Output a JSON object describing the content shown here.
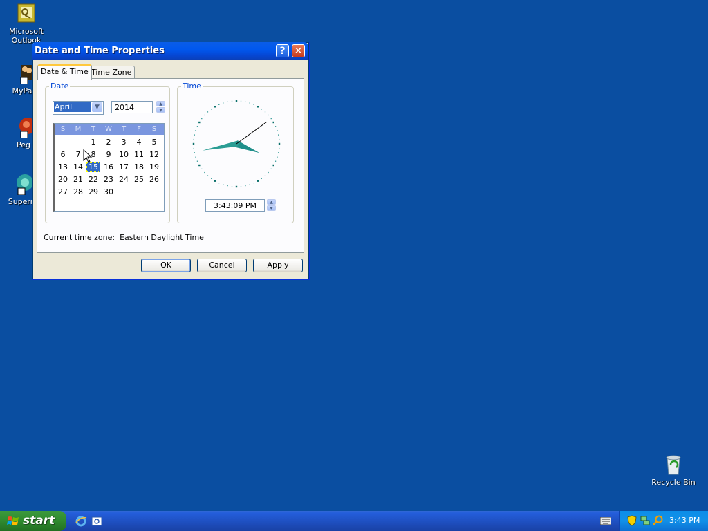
{
  "desktop": {
    "icons": [
      {
        "label": "Microsoft Outlook",
        "line1": "Microsoft",
        "line2": "Outlook"
      },
      {
        "label": "MyPa"
      },
      {
        "label": "Peg"
      },
      {
        "label": "Superr"
      }
    ],
    "recycle_bin": "Recycle Bin"
  },
  "dialog": {
    "title": "Date and Time Properties",
    "tabs": [
      "Date & Time",
      "Time Zone"
    ],
    "date_group": "Date",
    "time_group": "Time",
    "month": "April",
    "year": "2014",
    "weekdays": [
      "S",
      "M",
      "T",
      "W",
      "T",
      "F",
      "S"
    ],
    "calendar_days": [
      [
        "",
        "",
        "1",
        "2",
        "3",
        "4",
        "5"
      ],
      [
        "6",
        "7",
        "8",
        "9",
        "10",
        "11",
        "12"
      ],
      [
        "13",
        "14",
        "15",
        "16",
        "17",
        "18",
        "19"
      ],
      [
        "20",
        "21",
        "22",
        "23",
        "24",
        "25",
        "26"
      ],
      [
        "27",
        "28",
        "29",
        "30",
        "",
        "",
        ""
      ]
    ],
    "selected_day": "15",
    "time": "3:43:09 PM",
    "current_tz_label": "Current time zone:",
    "current_tz_value": "Eastern Daylight Time",
    "buttons": {
      "ok": "OK",
      "cancel": "Cancel",
      "apply": "Apply"
    },
    "help_glyph": "?",
    "close_glyph": "✕"
  },
  "taskbar": {
    "start": "start",
    "clock": "3:43 PM"
  },
  "colors": {
    "desktop": "#0a4ea1",
    "titlebar": "#0058ee",
    "selection": "#316ac5",
    "clock_hands": "#1f8f8a"
  }
}
